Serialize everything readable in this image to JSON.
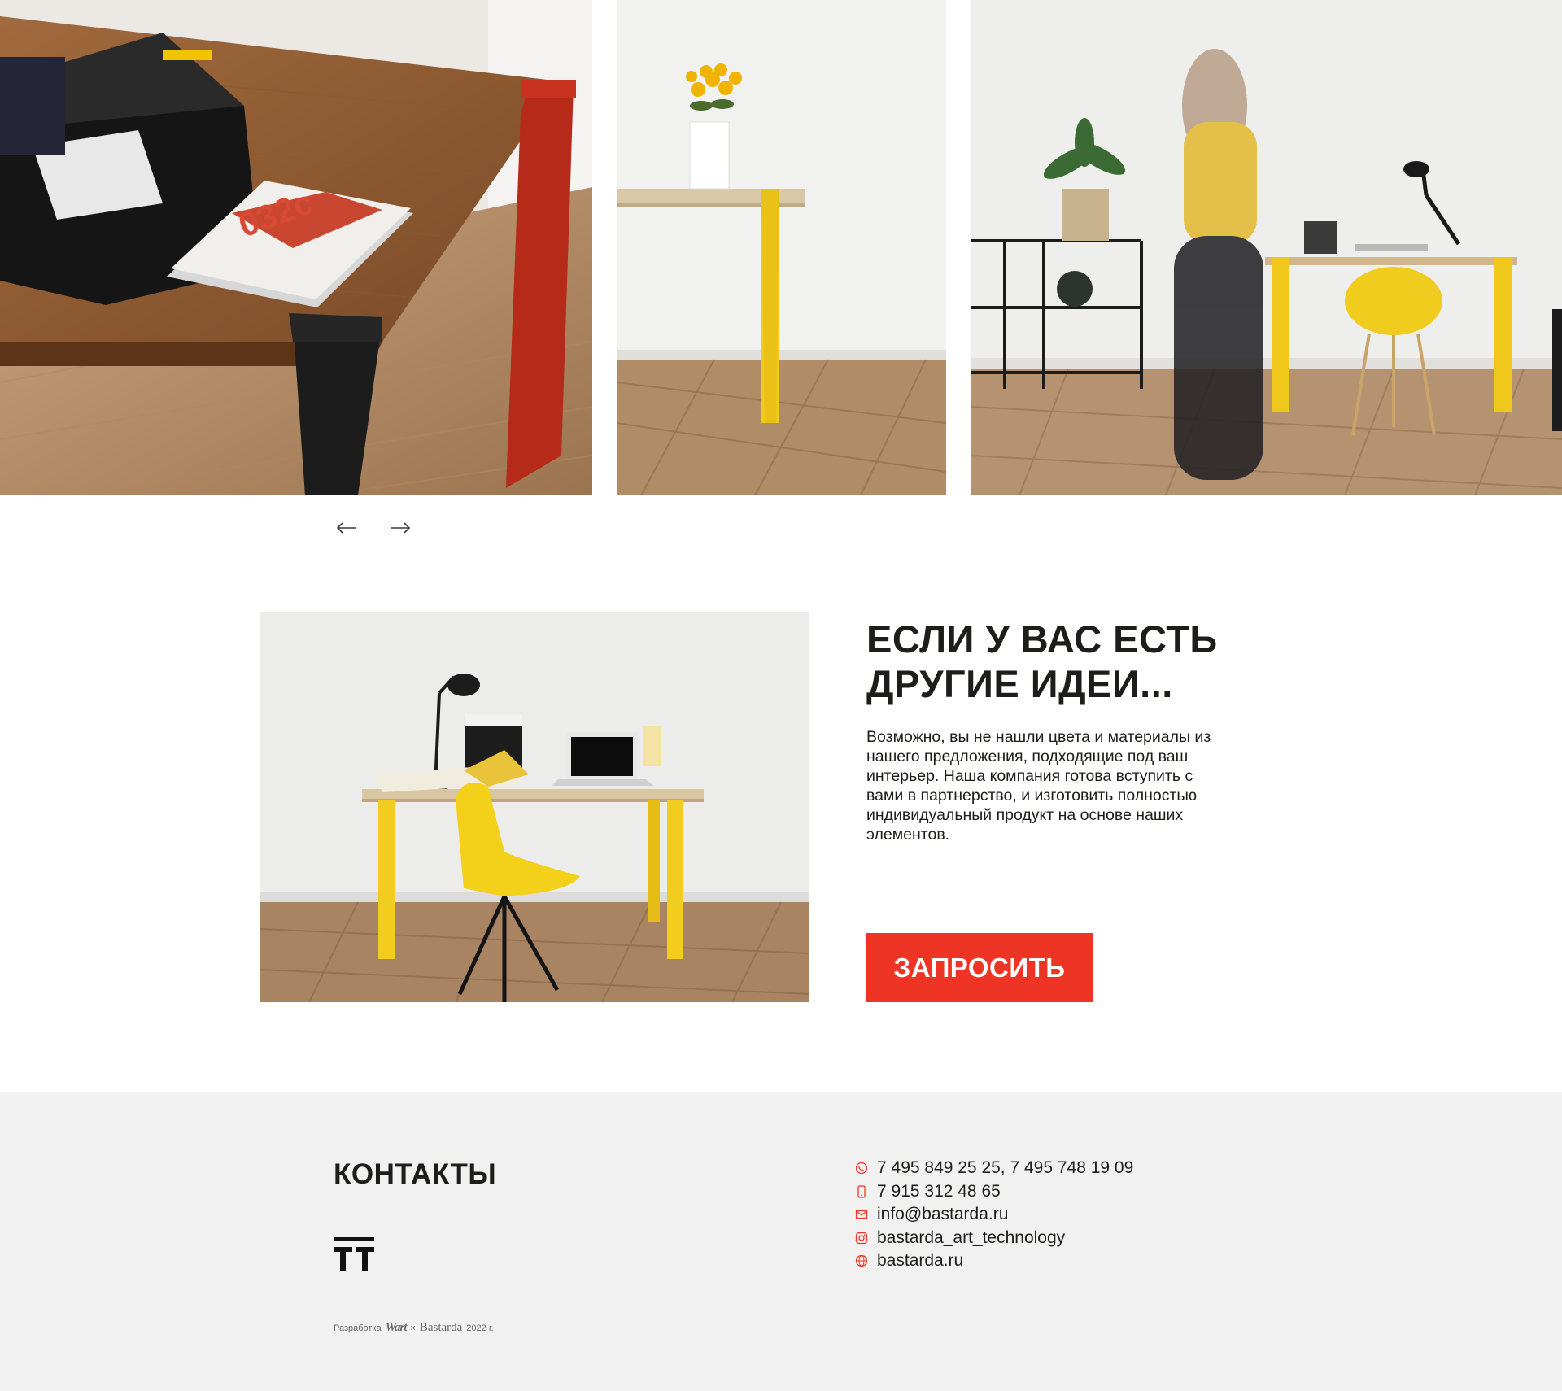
{
  "gallery": {
    "slides": [
      {
        "alt": "Wooden table with red and black legs, magazine 032c and black box"
      },
      {
        "alt": "Wall console with yellow leg and vase of yellow flowers"
      },
      {
        "alt": "Workspace with yellow-legged desk, yellow chair and walking woman"
      }
    ],
    "prev_icon": "arrow-left-icon",
    "next_icon": "arrow-right-icon"
  },
  "ideas": {
    "title_line1": "ЕСЛИ У ВАС ЕСТЬ",
    "title_line2": "ДРУГИЕ ИДЕИ...",
    "text": "Возможно, вы не нашли цвета и материалы из нашего предложения, подходящие под ваш интерьер. Наша компания готова вступить с вами в партнерство, и изготовить полностью индивидуальный продукт на основе наших элементов.",
    "button_label": "ЗАПРОСИТЬ",
    "photo_alt": "Desk with yellow legs, yellow chair, laptop and lamp"
  },
  "footer": {
    "title": "КОНТАКТЫ",
    "logo_icon": "tt-logo-icon",
    "contacts": [
      {
        "icon": "phone-icon",
        "text": "7 495 849 25 25, 7 495 748 19 09"
      },
      {
        "icon": "mobile-icon",
        "text": "7 915 312 48 65"
      },
      {
        "icon": "mail-icon",
        "text": "info@bastarda.ru"
      },
      {
        "icon": "instagram-icon",
        "text": "bastarda_art_technology"
      },
      {
        "icon": "globe-icon",
        "text": "bastarda.ru"
      }
    ],
    "credits": {
      "prefix": "Разработка",
      "studio": "Wart",
      "separator": "×",
      "brand": "Bastarda",
      "year": "2022 г."
    }
  },
  "colors": {
    "accent": "#ee3424",
    "footer_bg": "#f1f1f1",
    "text": "#1d1d1b"
  }
}
